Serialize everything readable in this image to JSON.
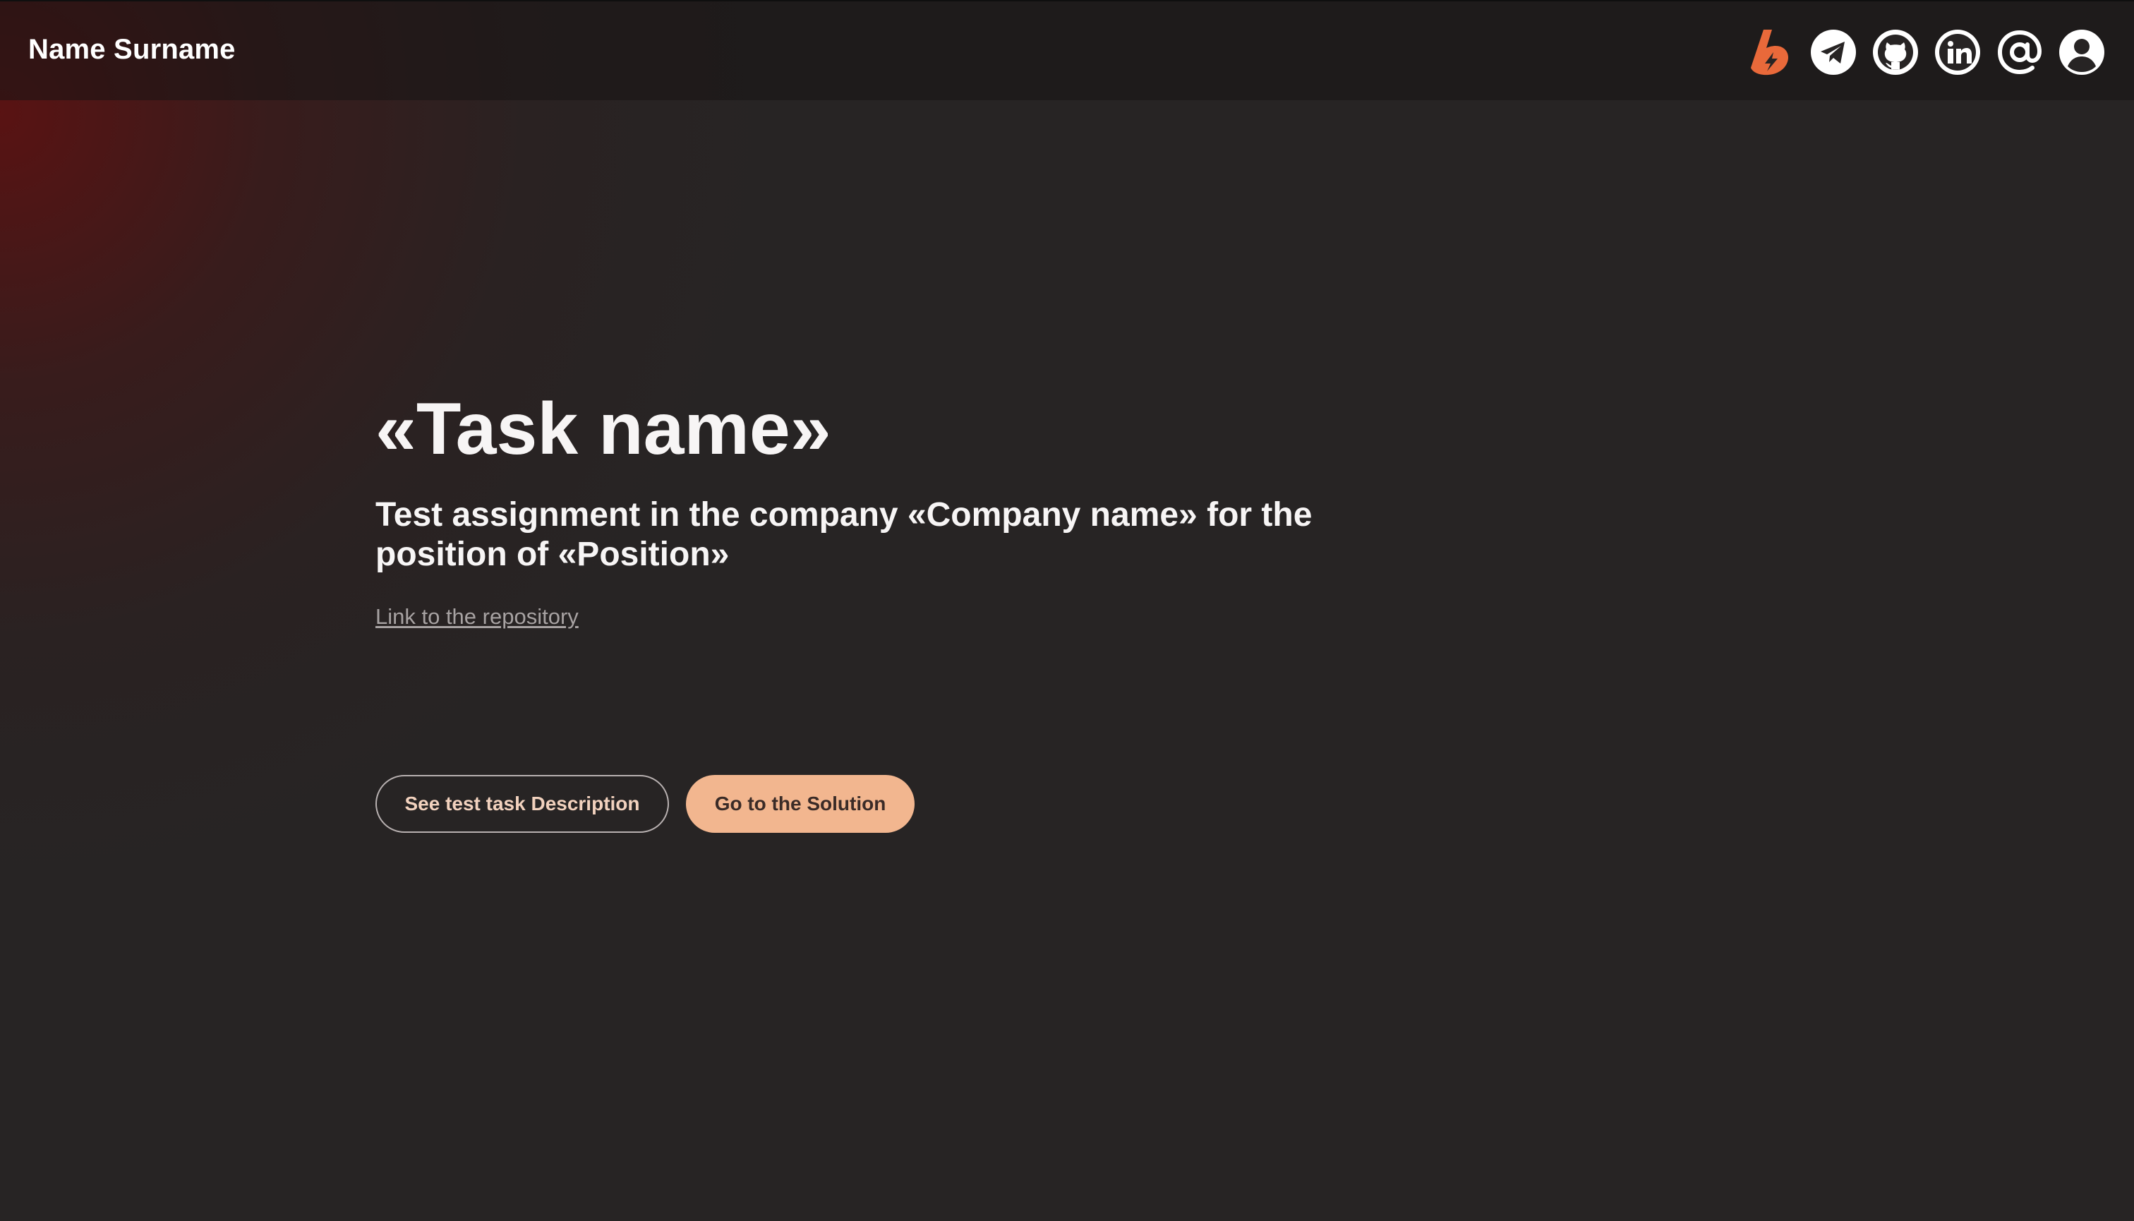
{
  "header": {
    "name": "Name Surname",
    "icons": [
      {
        "icon": "lightning-b-logo-icon",
        "color": "#e9693a"
      },
      {
        "icon": "telegram-icon",
        "color": "#ffffff"
      },
      {
        "icon": "github-icon",
        "color": "#ffffff"
      },
      {
        "icon": "linkedin-icon",
        "color": "#ffffff"
      },
      {
        "icon": "at-sign-icon",
        "color": "#ffffff"
      },
      {
        "icon": "user-icon",
        "color": "#ffffff"
      }
    ]
  },
  "hero": {
    "title": "«Task name»",
    "subtitle": "Test assignment in the company «Company name» for the position of «Position»",
    "repo_link": "Link to the repository"
  },
  "actions": {
    "description_button": "See test task Description",
    "solution_button": "Go to the Solution"
  },
  "colors": {
    "background": "#272424",
    "accent": "#f2b68f",
    "outline_text": "#f2d2be",
    "link": "#a7a2a2",
    "glow": "#780808"
  }
}
